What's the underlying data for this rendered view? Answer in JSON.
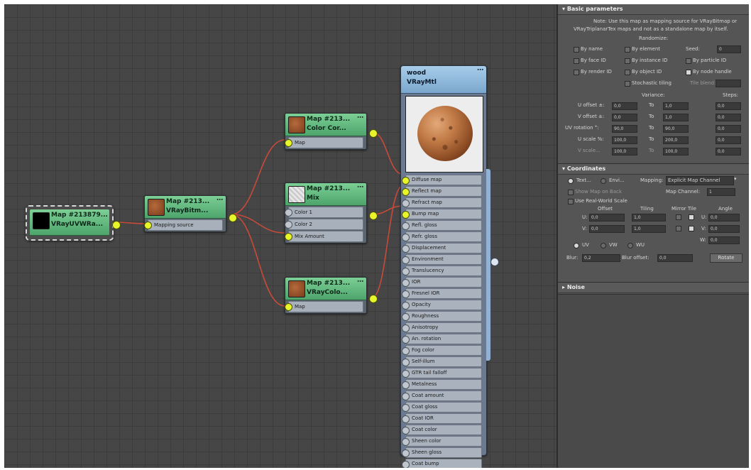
{
  "graph": {
    "nodes": {
      "uvw": {
        "name": "Map #213879...",
        "type": "VRayUVWRa..."
      },
      "bitmap": {
        "name": "Map #213...",
        "type": "VRayBitm...",
        "ports": [
          "Mapping source"
        ]
      },
      "cc": {
        "name": "Map #213...",
        "type": "Color Cor...",
        "ports": [
          "Map"
        ]
      },
      "mix": {
        "name": "Map #213...",
        "type": "Mix",
        "ports": [
          "Color 1",
          "Color 2",
          "Mix Amount"
        ]
      },
      "vcolor": {
        "name": "Map #213...",
        "type": "VRayColo...",
        "ports": [
          "Map"
        ]
      },
      "mtl": {
        "name": "wood",
        "type": "VRayMtl",
        "ports": [
          "Diffuse map",
          "Reflect map",
          "Refract map",
          "Bump map",
          "Refl. gloss",
          "Refr. gloss",
          "Displacement",
          "Environment",
          "Translucency",
          "IOR",
          "Fresnel IOR",
          "Opacity",
          "Roughness",
          "Anisotropy",
          "An. rotation",
          "Fog color",
          "Self-illum",
          "GTR tail falloff",
          "Metalness",
          "Coat amount",
          "Coat gloss",
          "Coat IOR",
          "Coat color",
          "Sheen color",
          "Sheen gloss",
          "Coat bump"
        ]
      }
    }
  },
  "panel": {
    "basic": {
      "title": "Basic parameters",
      "note1": "Note: Use this map as mapping source for VRayBitmap or",
      "note2": "VRayTriplanarTex maps and not as a standalone map by itself.",
      "randomize": "Randomize:",
      "by_name": "By name",
      "by_element": "By element",
      "seed_label": "Seed:",
      "seed_value": "0",
      "by_face_id": "By face ID",
      "by_instance_id": "By instance ID",
      "by_particle_id": "By particle ID",
      "by_render_id": "By render ID",
      "by_object_id": "By object ID",
      "by_node_handle": "By node handle",
      "stochastic": "Stochastic tiling",
      "tile_blend": "Tile blend:",
      "variance": "Variance:",
      "steps": "Steps:",
      "to": "To",
      "rows": [
        {
          "label": "U offset ±:",
          "from": "0,0",
          "to": "1,0",
          "step": "0,0"
        },
        {
          "label": "V offset ±:",
          "from": "0,0",
          "to": "1,0",
          "step": "0,0"
        },
        {
          "label": "UV rotation °:",
          "from": "90,0",
          "to": "90,0",
          "step": "0,0"
        },
        {
          "label": "U scale %:",
          "from": "100,0",
          "to": "200,0",
          "step": "0,0"
        },
        {
          "label": "V scale...",
          "from": "100,0",
          "to": "100,0",
          "step": "0,0"
        }
      ]
    },
    "coords": {
      "title": "Coordinates",
      "texture": "Text...",
      "environ": "Envi...",
      "mapping_label": "Mapping:",
      "mapping_value": "Explicit Map Channel",
      "show_map": "Show Map on Back",
      "map_channel_label": "Map Channel:",
      "map_channel_value": "1",
      "real_world": "Use Real-World Scale",
      "offset": "Offset",
      "tiling": "Tiling",
      "mirror_tile": "Mirror Tile",
      "angle": "Angle",
      "u_label": "U:",
      "v_label": "V:",
      "w_label": "W:",
      "u_offset": "0,0",
      "v_offset": "0,0",
      "u_tiling": "1,0",
      "v_tiling": "1,0",
      "u_angle": "0,0",
      "v_angle": "0,0",
      "w_angle": "0,0",
      "uv": "UV",
      "vw": "VW",
      "wu": "WU",
      "blur_label": "Blur:",
      "blur_value": "0,2",
      "blur_offset_label": "Blur offset:",
      "blur_offset_value": "0,0",
      "rotate": "Rotate"
    },
    "noise": {
      "title": "Noise"
    }
  }
}
